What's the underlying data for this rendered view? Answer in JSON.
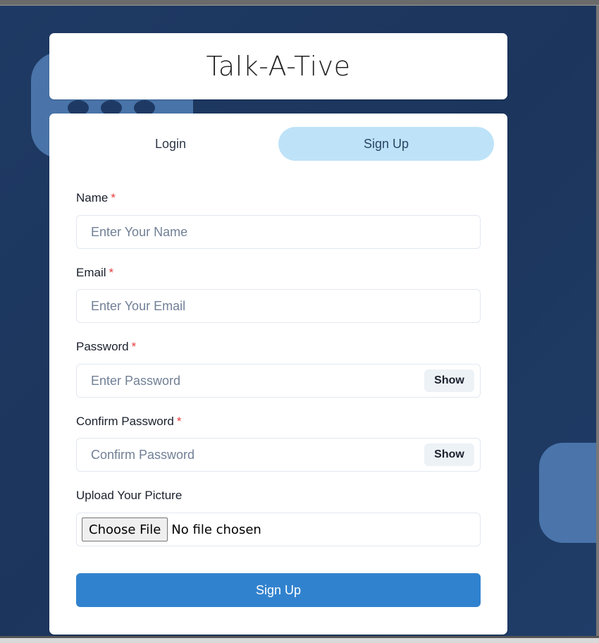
{
  "app": {
    "title": "Talk-A-Tive"
  },
  "tabs": [
    {
      "label": "Login",
      "active": false
    },
    {
      "label": "Sign Up",
      "active": true
    }
  ],
  "form": {
    "name": {
      "label": "Name",
      "required_mark": "*",
      "placeholder": "Enter Your Name",
      "value": ""
    },
    "email": {
      "label": "Email",
      "required_mark": "*",
      "placeholder": "Enter Your Email",
      "value": ""
    },
    "password": {
      "label": "Password",
      "required_mark": "*",
      "placeholder": "Enter Password",
      "value": "",
      "toggle_label": "Show"
    },
    "confirm_password": {
      "label": "Confirm Password",
      "required_mark": "*",
      "placeholder": "Confirm Password",
      "value": "",
      "toggle_label": "Show"
    },
    "picture": {
      "label": "Upload Your Picture",
      "button_label": "Choose File",
      "status": "No file chosen"
    },
    "submit_label": "Sign Up"
  },
  "colors": {
    "background": "#1e3a64",
    "active_tab": "#bee3f8",
    "primary_button": "#3182ce",
    "required": "#e53e3e"
  }
}
